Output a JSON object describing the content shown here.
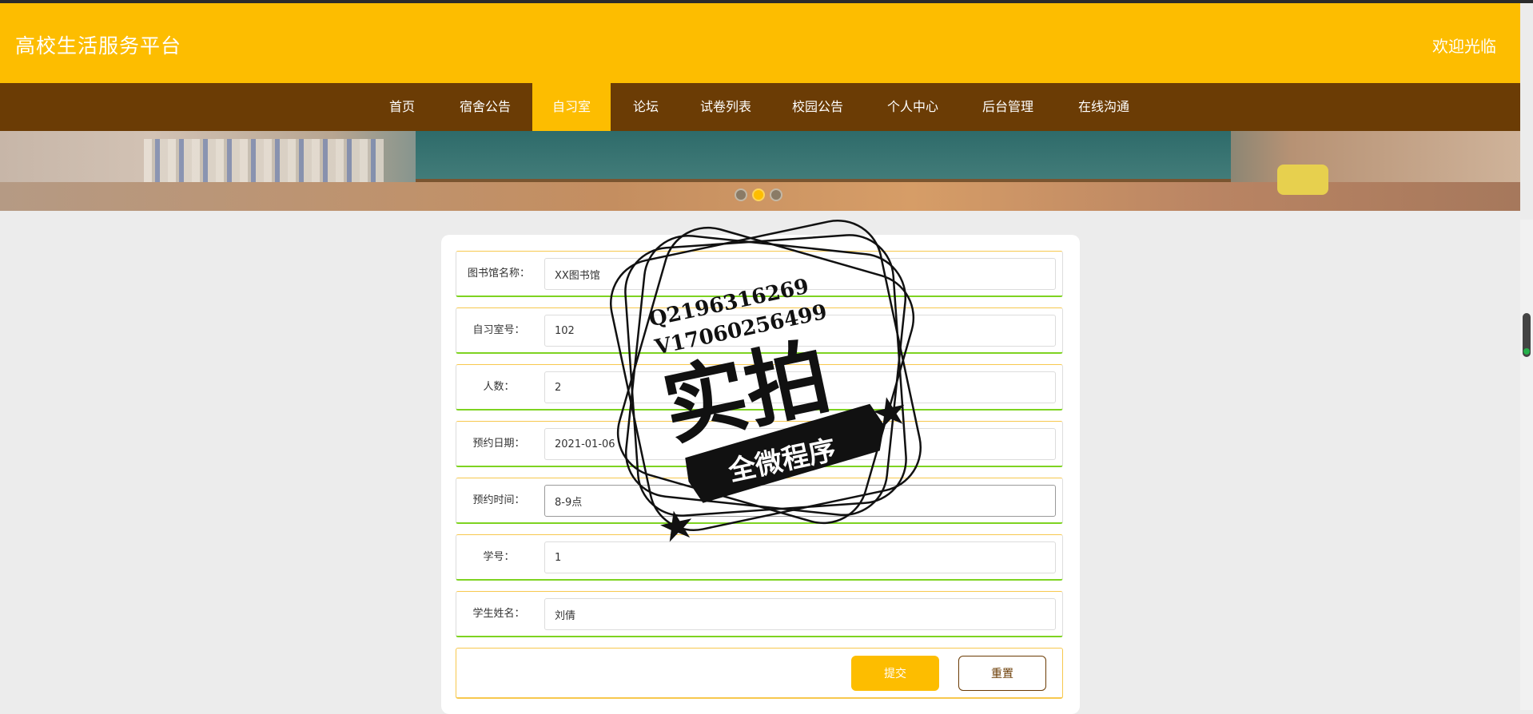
{
  "header": {
    "site_title": "高校生活服务平台",
    "welcome": "欢迎光临"
  },
  "nav": {
    "items": [
      {
        "label": "首页"
      },
      {
        "label": "宿舍公告"
      },
      {
        "label": "自习室"
      },
      {
        "label": "论坛"
      },
      {
        "label": "试卷列表"
      },
      {
        "label": "校园公告"
      },
      {
        "label": "个人中心"
      },
      {
        "label": "后台管理"
      },
      {
        "label": "在线沟通"
      }
    ],
    "active": "自习室"
  },
  "banner": {
    "slide_count": 3,
    "active_slide": 2
  },
  "form": {
    "fields": [
      {
        "label": "图书馆名称：",
        "value": "XX图书馆"
      },
      {
        "label": "自习室号：",
        "value": "102"
      },
      {
        "label": "人数：",
        "value": "2"
      },
      {
        "label": "预约日期：",
        "value": "2021-01-06"
      },
      {
        "label": "预约时间：",
        "value": "8-9点"
      },
      {
        "label": "学号：",
        "value": "1"
      },
      {
        "label": "学生姓名：",
        "value": "刘倩"
      }
    ],
    "submit_label": "提交",
    "reset_label": "重置"
  },
  "watermark": {
    "line1": "Q2196316269",
    "line2": "V17060256499",
    "big": "实拍",
    "ribbon": "全微程序"
  },
  "colors": {
    "accent": "#fdbd00",
    "nav_bg": "#6b3c05",
    "border_green": "#7ed321"
  }
}
